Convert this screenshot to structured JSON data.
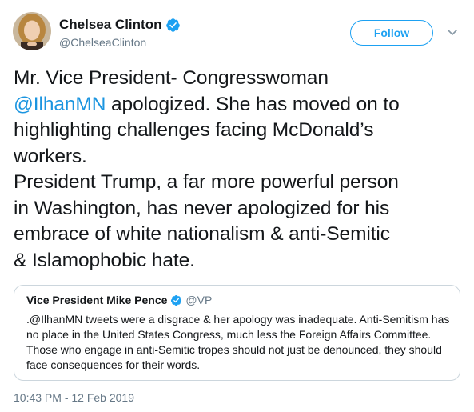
{
  "author": {
    "name": "Chelsea Clinton",
    "handle": "@ChelseaClinton"
  },
  "follow_label": "Follow",
  "tweet": {
    "lines": [
      {
        "text": "Mr. Vice President- Congresswoman"
      },
      {
        "mention": "@IlhanMN",
        "after": " apologized. She has moved on to"
      },
      {
        "text": "highlighting challenges facing McDonald’s"
      },
      {
        "text": "workers."
      },
      {
        "text": "President Trump, a far more powerful person"
      },
      {
        "text": "in Washington, has never apologized for his"
      },
      {
        "text": "embrace of white nationalism & anti-Semitic"
      },
      {
        "text": "& Islamophobic hate."
      }
    ]
  },
  "quoted": {
    "name": "Vice President Mike Pence",
    "handle": "@VP",
    "lines": [
      ".@IlhanMN tweets were a disgrace & her apology was inadequate. Anti-Semitism has",
      "no place in the United States Congress, much less the Foreign Affairs Committee.",
      "Those who engage in anti-Semitic tropes should not just be denounced, they should",
      "face consequences for their words."
    ]
  },
  "timestamp": "10:43 PM - 12 Feb 2019",
  "colors": {
    "link": "#1b95e0",
    "follow": "#1da1f2",
    "secondary_text": "#657786",
    "border": "#ccd6dd"
  },
  "icons": [
    "avatar",
    "verified-badge-icon",
    "chevron-down-icon"
  ]
}
